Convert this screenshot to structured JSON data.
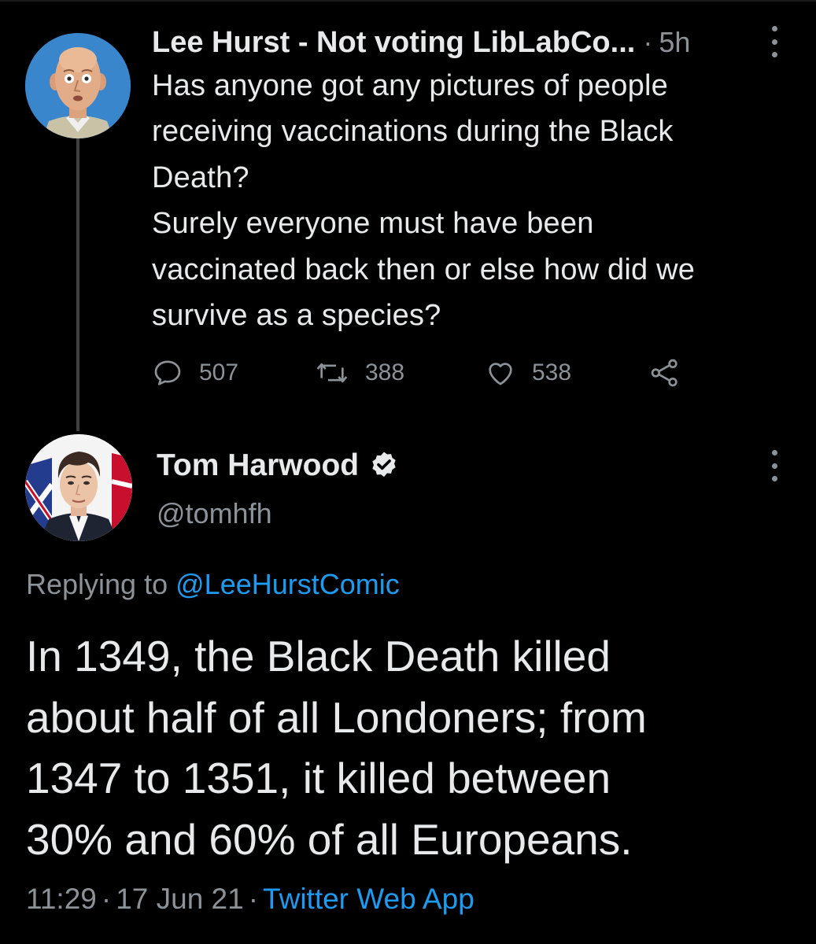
{
  "thread": {
    "parent": {
      "author_name": "Lee Hurst - Not voting LibLabCo...",
      "separator": "·",
      "time_ago": "5h",
      "body_lines": [
        "Has anyone got any pictures of people",
        "receiving vaccinations during the Black",
        "Death?",
        "Surely everyone must have been",
        "vaccinated back then or else how did we",
        "survive as a species?"
      ],
      "actions": {
        "reply_count": "507",
        "retweet_count": "388",
        "like_count": "538"
      },
      "icons": [
        "reply-icon",
        "retweet-icon",
        "like-icon",
        "share-icon",
        "more-icon"
      ]
    },
    "reply": {
      "author_name": "Tom Harwood",
      "handle": "@tomhfh",
      "replying_prefix": "Replying to",
      "replying_mention": "@LeeHurstComic",
      "body_lines": [
        "In 1349, the Black Death killed",
        "about half of all Londoners; from",
        "1347 to 1351, it killed between",
        "30% and 60% of all Europeans."
      ],
      "time": "11:29",
      "date": "17 Jun 21",
      "separator": "·",
      "source": "Twitter Web App",
      "icons": [
        "verified-icon",
        "more-icon"
      ]
    }
  },
  "colors": {
    "background": "#000000",
    "primary_text": "#e7e9ea",
    "secondary_text": "#8b9298",
    "link_blue": "#1d9bf0",
    "thread_line": "#3d4145"
  }
}
